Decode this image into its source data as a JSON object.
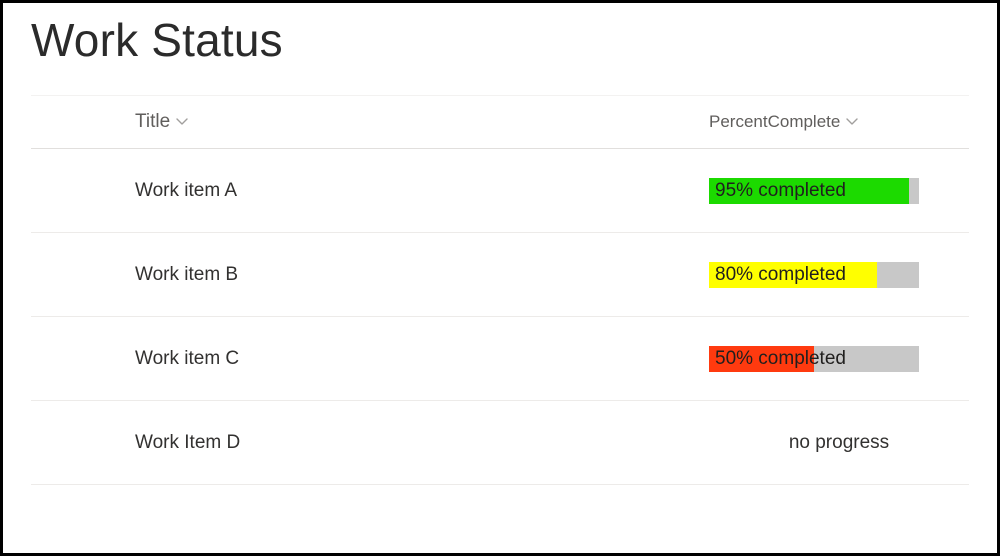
{
  "page": {
    "title": "Work Status"
  },
  "list": {
    "columns": {
      "title": "Title",
      "percentComplete": "PercentComplete"
    },
    "rows": [
      {
        "title": "Work item A",
        "percent": 95,
        "label": "95% completed",
        "color": "#1cda00"
      },
      {
        "title": "Work item B",
        "percent": 80,
        "label": "80% completed",
        "color": "#ffff00"
      },
      {
        "title": "Work item C",
        "percent": 50,
        "label": "50% completed",
        "color": "#ff3a0f"
      },
      {
        "title": "Work Item D",
        "percent": 0,
        "label": "no progress",
        "color": null
      }
    ]
  },
  "chart_data": {
    "type": "bar",
    "title": "Work Status — PercentComplete",
    "categories": [
      "Work item A",
      "Work item B",
      "Work item C",
      "Work Item D"
    ],
    "values": [
      95,
      80,
      50,
      0
    ],
    "xlabel": "Title",
    "ylabel": "PercentComplete",
    "ylim": [
      0,
      100
    ]
  }
}
